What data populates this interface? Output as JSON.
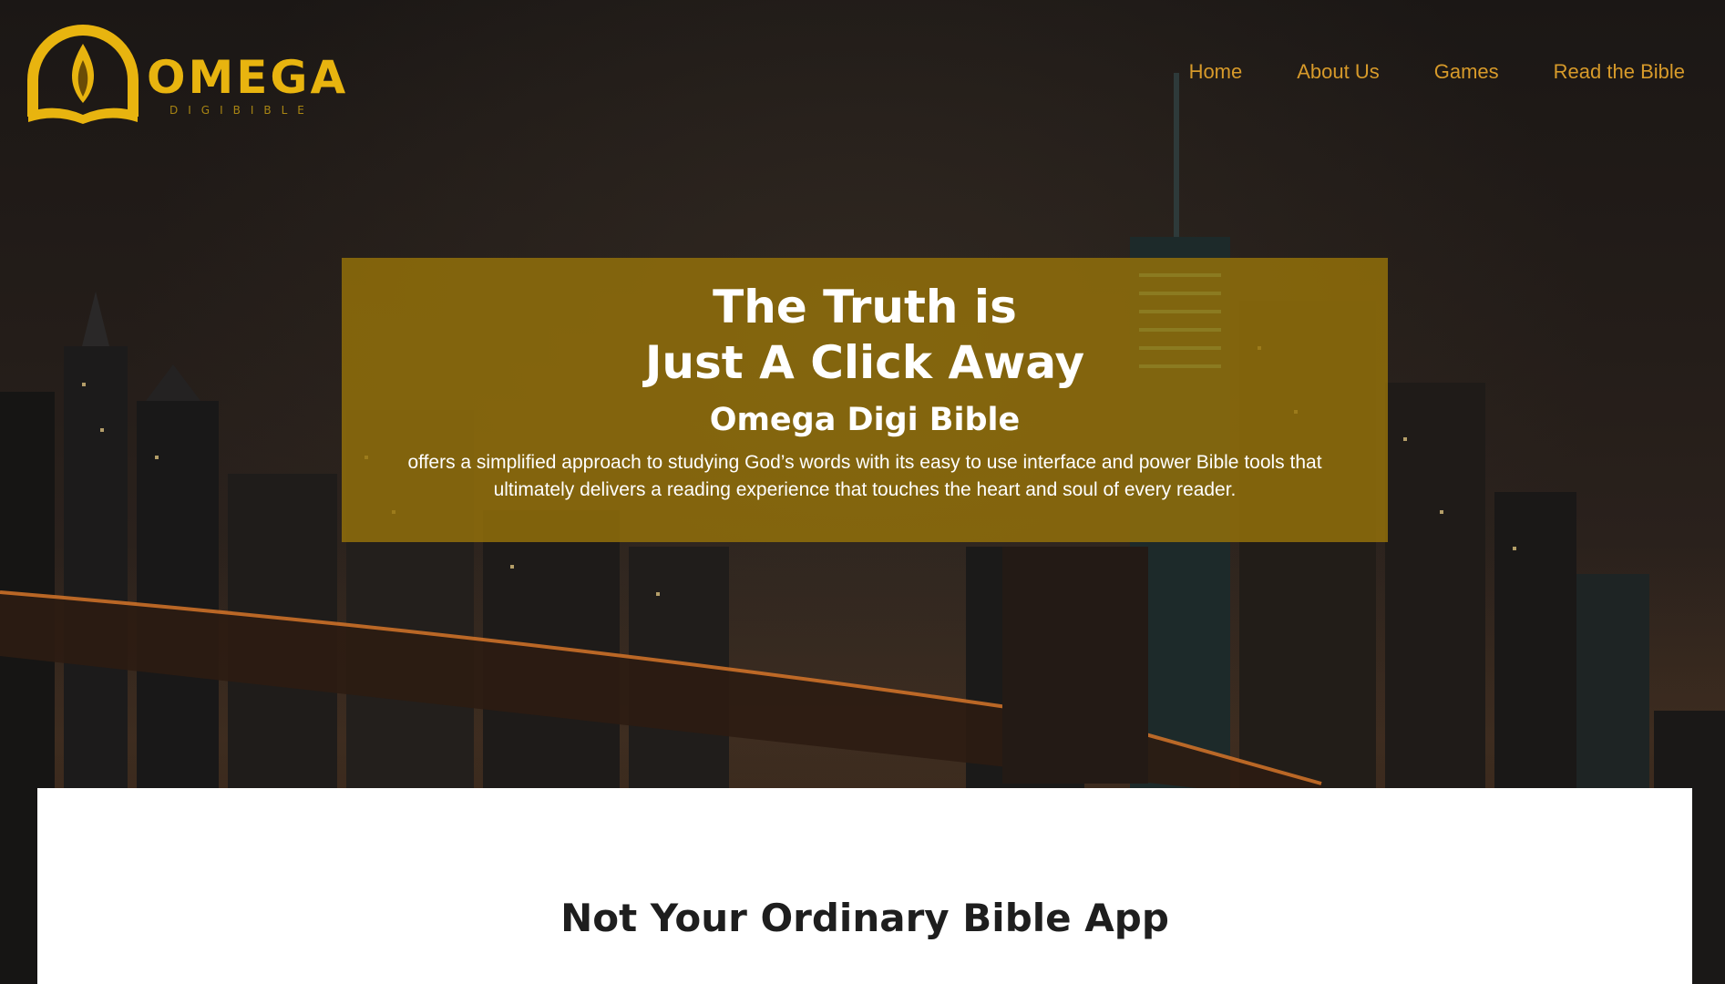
{
  "brand": {
    "name": "OMEGA",
    "tagline": "DIGIBIBLE",
    "color": "#e8b40f"
  },
  "nav": {
    "items": [
      {
        "label": "Home"
      },
      {
        "label": "About Us"
      },
      {
        "label": "Games"
      },
      {
        "label": "Read the Bible"
      }
    ],
    "color": "#d79a2a"
  },
  "hero": {
    "title_line1": "The Truth is",
    "title_line2": "Just A Click Away",
    "subtitle": "Omega Digi Bible",
    "description_line1": "offers a simplified approach to studying God’s words with its easy to use interface and power Bible tools that",
    "description_line2": "ultimately delivers a reading experience that touches the heart and soul of every reader.",
    "box_color": "#96730a"
  },
  "section": {
    "title": "Not Your Ordinary Bible App"
  }
}
